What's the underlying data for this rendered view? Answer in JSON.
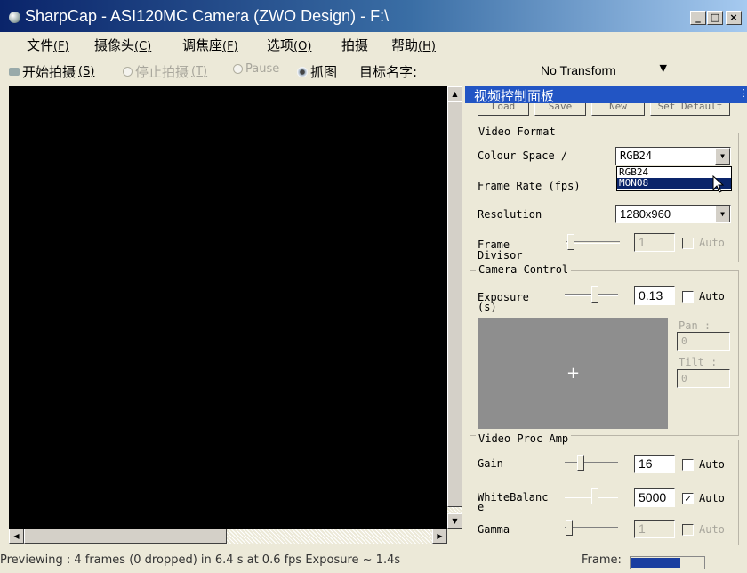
{
  "window": {
    "title": "SharpCap - ASI120MC Camera (ZWO Design) - F:\\",
    "minimize": "_",
    "maximize": "□",
    "close": "×"
  },
  "menu": [
    {
      "label": "文件",
      "accel": "(F)"
    },
    {
      "label": "摄像头",
      "accel": "(C)"
    },
    {
      "label": "调焦座",
      "accel": "(F)"
    },
    {
      "label": "选项",
      "accel": "(O)"
    },
    {
      "label": "拍摄",
      "accel": ""
    },
    {
      "label": "帮助",
      "accel": "(H)"
    }
  ],
  "toolbar": {
    "start_capture": "开始拍摄",
    "start_accel": "(S)",
    "stop_capture": "停止拍摄",
    "stop_accel": "(T)",
    "pause": "Pause",
    "snapshot": "抓图",
    "target_name_label": "目标名字:",
    "target_name_value": "",
    "transform": "No Transform"
  },
  "panel": {
    "title": "视频控制面板",
    "buttons": [
      "Load",
      "Save",
      "New",
      "Set Default"
    ],
    "video_format": {
      "title": "Video Format",
      "colour_space_label": "Colour Space /",
      "colour_space_value": "RGB24",
      "colour_space_options": [
        "RGB24",
        "MONO8"
      ],
      "colour_space_highlighted": "MONO8",
      "frame_rate_label": "Frame Rate (fps)",
      "resolution_label": "Resolution",
      "resolution_value": "1280x960",
      "frame_divisor_label_1": "Frame",
      "frame_divisor_label_2": "Divisor",
      "frame_divisor_value": "1",
      "frame_divisor_auto": "Auto"
    },
    "camera_control": {
      "title": "Camera Control",
      "exposure_label_1": "Exposure",
      "exposure_label_2": "(s)",
      "exposure_value": "0.13",
      "exposure_auto": "Auto",
      "exposure_auto_checked": false,
      "pan_label": "Pan :",
      "pan_value": "0",
      "tilt_label": "Tilt :",
      "tilt_value": "0",
      "crosshair": "+"
    },
    "video_proc_amp": {
      "title": "Video Proc Amp",
      "gain_label": "Gain",
      "gain_value": "16",
      "gain_auto": "Auto",
      "gain_auto_checked": false,
      "white_balance_label_1": "WhiteBalanc",
      "white_balance_label_2": "e",
      "white_balance_value": "5000",
      "white_balance_auto": "Auto",
      "white_balance_auto_checked": true,
      "gamma_label": "Gamma",
      "gamma_value": "1",
      "gamma_auto": "Auto"
    }
  },
  "status": {
    "text": "Previewing : 4 frames (0 dropped) in 6.4 s at 0.6 fps  Exposure ~ 1.4s",
    "frame_label": "Frame:",
    "frame_progress": 0.68
  },
  "colors": {
    "title_bar": "#0a246a",
    "panel_title": "#2255c4",
    "selection": "#0a246a",
    "frame_fill": "#1a3ea0"
  }
}
